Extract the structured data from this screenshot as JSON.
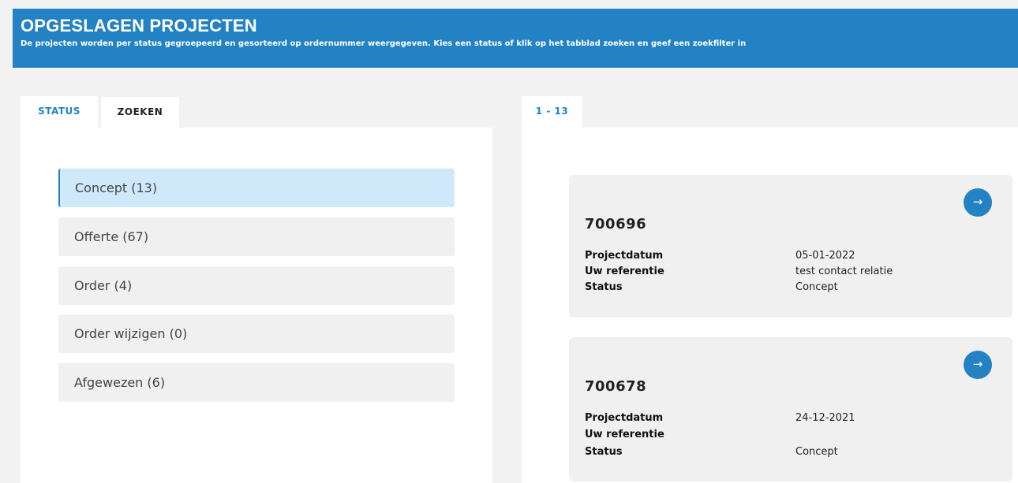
{
  "header": {
    "title": "OPGESLAGEN PROJECTEN",
    "subtitle": "De projecten worden per status gegroepeerd en gesorteerd op ordernummer weergegeven. Kies een status of klik op het tabblad zoeken en geef een zoekfilter in",
    "background": "#2382c4"
  },
  "tabs": {
    "status": "STATUS",
    "zoeken": "ZOEKEN",
    "range": "1 - 13"
  },
  "statuses": [
    {
      "label": "Concept (13)",
      "active": true
    },
    {
      "label": "Offerte (67)",
      "active": false
    },
    {
      "label": "Order (4)",
      "active": false
    },
    {
      "label": "Order wijzigen (0)",
      "active": false
    },
    {
      "label": "Afgewezen (6)",
      "active": false
    }
  ],
  "labels": {
    "projectdatum": "Projectdatum",
    "referentie": "Uw referentie",
    "status": "Status"
  },
  "projects": [
    {
      "number": "700696",
      "date": "05-01-2022",
      "reference": "test contact relatie",
      "status": "Concept",
      "icon": "arrow-right-icon"
    },
    {
      "number": "700678",
      "date": "24-12-2021",
      "reference": "",
      "status": "Concept",
      "icon": "arrow-right-icon"
    }
  ],
  "colors": {
    "accent": "#2382c4",
    "active_status": "#cfe9fb"
  }
}
